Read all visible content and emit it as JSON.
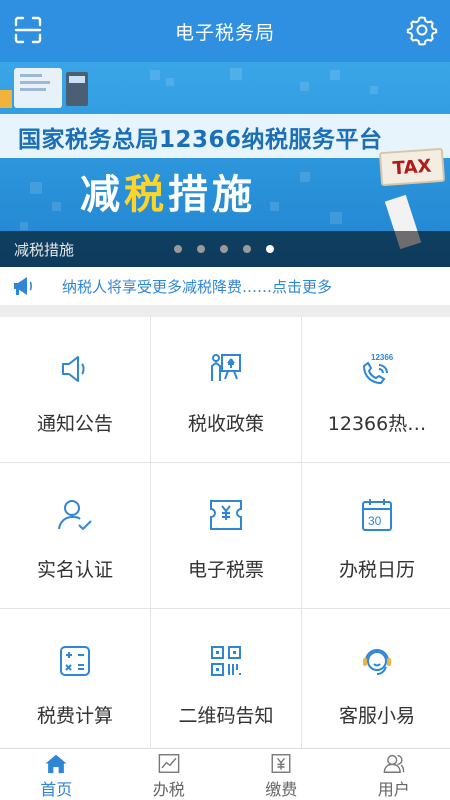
{
  "header": {
    "title": "电子税务局",
    "scan_icon": "scan-icon",
    "settings_icon": "gear-icon"
  },
  "banner": {
    "headline": "国家税务总局12366纳税服务平台",
    "subtitle_prefix": "减",
    "subtitle_highlight": "税",
    "subtitle_suffix": "措施",
    "tax_sign": "TAX",
    "caption": "减税措施",
    "slide_count": 5,
    "active_slide": 5
  },
  "notice": {
    "text": "纳税人将享受更多减税降费……点击更多",
    "icon": "megaphone-icon"
  },
  "grid": {
    "items": [
      {
        "label": "通知公告",
        "icon": "speaker-icon"
      },
      {
        "label": "税收政策",
        "icon": "presentation-icon"
      },
      {
        "label": "12366热…",
        "icon": "hotline-icon"
      },
      {
        "label": "实名认证",
        "icon": "user-check-icon"
      },
      {
        "label": "电子税票",
        "icon": "ticket-icon"
      },
      {
        "label": "办税日历",
        "icon": "calendar-icon",
        "calendar_day": "30"
      },
      {
        "label": "税费计算",
        "icon": "calculator-icon"
      },
      {
        "label": "二维码告知",
        "icon": "qrcode-icon"
      },
      {
        "label": "客服小易",
        "icon": "agent-icon"
      }
    ]
  },
  "tabs": [
    {
      "label": "首页",
      "icon": "home-icon",
      "active": true
    },
    {
      "label": "办税",
      "icon": "chart-icon",
      "active": false
    },
    {
      "label": "缴费",
      "icon": "yuan-icon",
      "active": false
    },
    {
      "label": "用户",
      "icon": "users-icon",
      "active": false
    }
  ],
  "colors": {
    "brand": "#2f8fe0",
    "accent_text": "#2f86d6",
    "highlight": "#ffd42a"
  }
}
